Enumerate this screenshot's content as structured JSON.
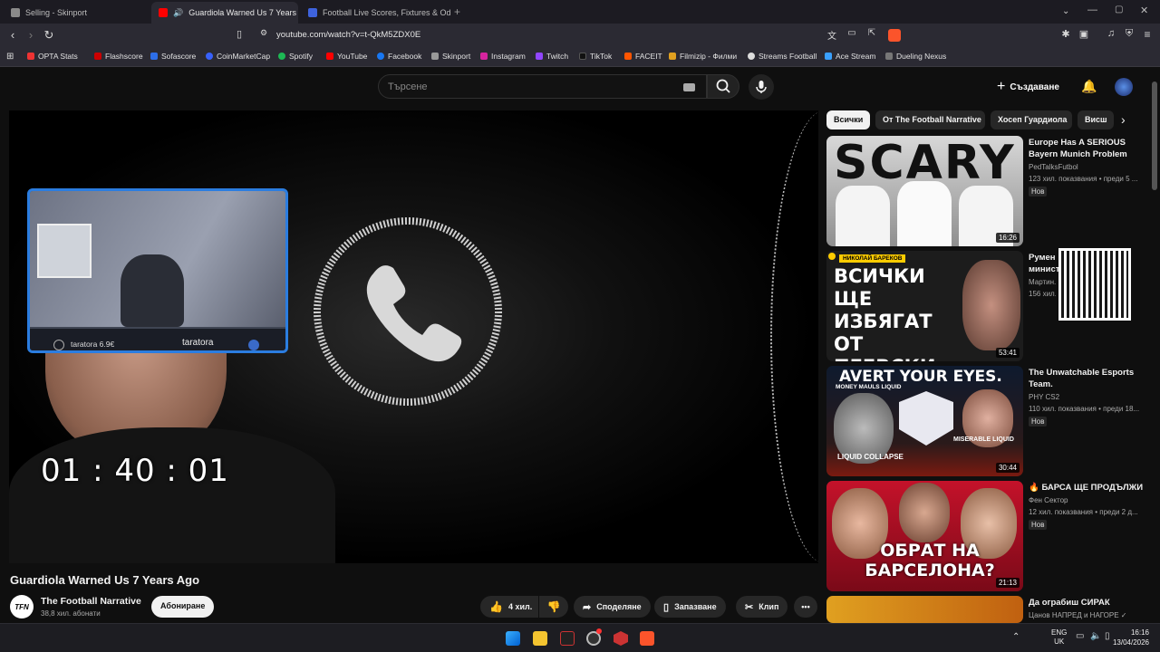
{
  "tabs": [
    {
      "title": "Selling - Skinport",
      "active": false
    },
    {
      "title": "Guardiola Warned Us 7 Years",
      "active": true
    },
    {
      "title": "Football Live Scores, Fixtures & Odds",
      "active": false
    }
  ],
  "address": {
    "url": "youtube.com/watch?v=t-QkM5ZDX0E"
  },
  "bookmarks": [
    "OPTA Stats",
    "Flashscore",
    "Sofascore",
    "CoinMarketCap",
    "Spotify",
    "YouTube",
    "Facebook",
    "Skinport",
    "Instagram",
    "Twitch",
    "TikTok",
    "FACEIT",
    "Filmizip - Филми",
    "Streams Football",
    "Ace Stream",
    "Dueling Nexus"
  ],
  "youtube": {
    "search_placeholder": "Търсене",
    "create_label": "Създаване"
  },
  "player": {
    "timer": "01 : 40 : 01",
    "webcam": {
      "donation": "taratora 6.9€",
      "name": "taratora"
    }
  },
  "video": {
    "title": "Guardiola Warned Us 7 Years Ago",
    "channel": "The Football Narrative",
    "channel_logo": "TFN",
    "subscribers": "38,8 хил. абонати",
    "subscribe_label": "Абониране",
    "likes": "4 хил.",
    "share_label": "Споделяне",
    "save_label": "Запазване",
    "clip_label": "Клип"
  },
  "chips": [
    "Всички",
    "От The Football Narrative",
    "Хосеп Гуардиола",
    "Висш"
  ],
  "recommendations": [
    {
      "title": "Europe Has A SERIOUS Bayern Munich Problem",
      "channel": "PedTalksFutbol",
      "meta": "123 хил. показвания • преди 5 ...",
      "badge": "Нов",
      "duration": "16:26",
      "thumb_text": "SCARY"
    },
    {
      "title": "Румен министр...",
      "channel": "Мартин...",
      "meta": "156 хил...",
      "badge": "",
      "duration": "53:41",
      "thumb_tag": "НИКОЛАЙ БАРЕКОВ",
      "thumb_text": "ВСИЧКИ ЩЕ ИЗБЯГАТ ОТ ПЕЕВСКИ"
    },
    {
      "title": "The Unwatchable Esports Team.",
      "channel": "PHY CS2",
      "meta": "110 хил. показвания • преди 18...",
      "badge": "Нов",
      "duration": "30:44",
      "thumb_text": "AVERT YOUR EYES.",
      "thumb_labels": [
        "MONEY MAULS LIQUID",
        "MISERABLE LIQUID",
        "LIQUID COLLAPSE"
      ]
    },
    {
      "title": "🔥 БАРСА ЩЕ ПРОДЪЛЖИ",
      "channel": "Фен Сектор",
      "meta": "12 хил. показвания • преди 2 д...",
      "badge": "Нов",
      "duration": "21:13",
      "thumb_text": "ОБРАТ НА БАРСЕЛОНА?"
    },
    {
      "title": "Да ограбиш СИРАК",
      "channel": "Цанов НАПРЕД и НАГОРЕ ✓",
      "meta": "",
      "badge": "",
      "duration": ""
    }
  ],
  "taskbar": {
    "lang": "ENG",
    "region": "UK",
    "time": "16:16",
    "date": "13/04/2026"
  },
  "colors": {
    "accent": "#2b7de0",
    "youtube_red": "#ff0000",
    "brave": "#fb542b"
  }
}
